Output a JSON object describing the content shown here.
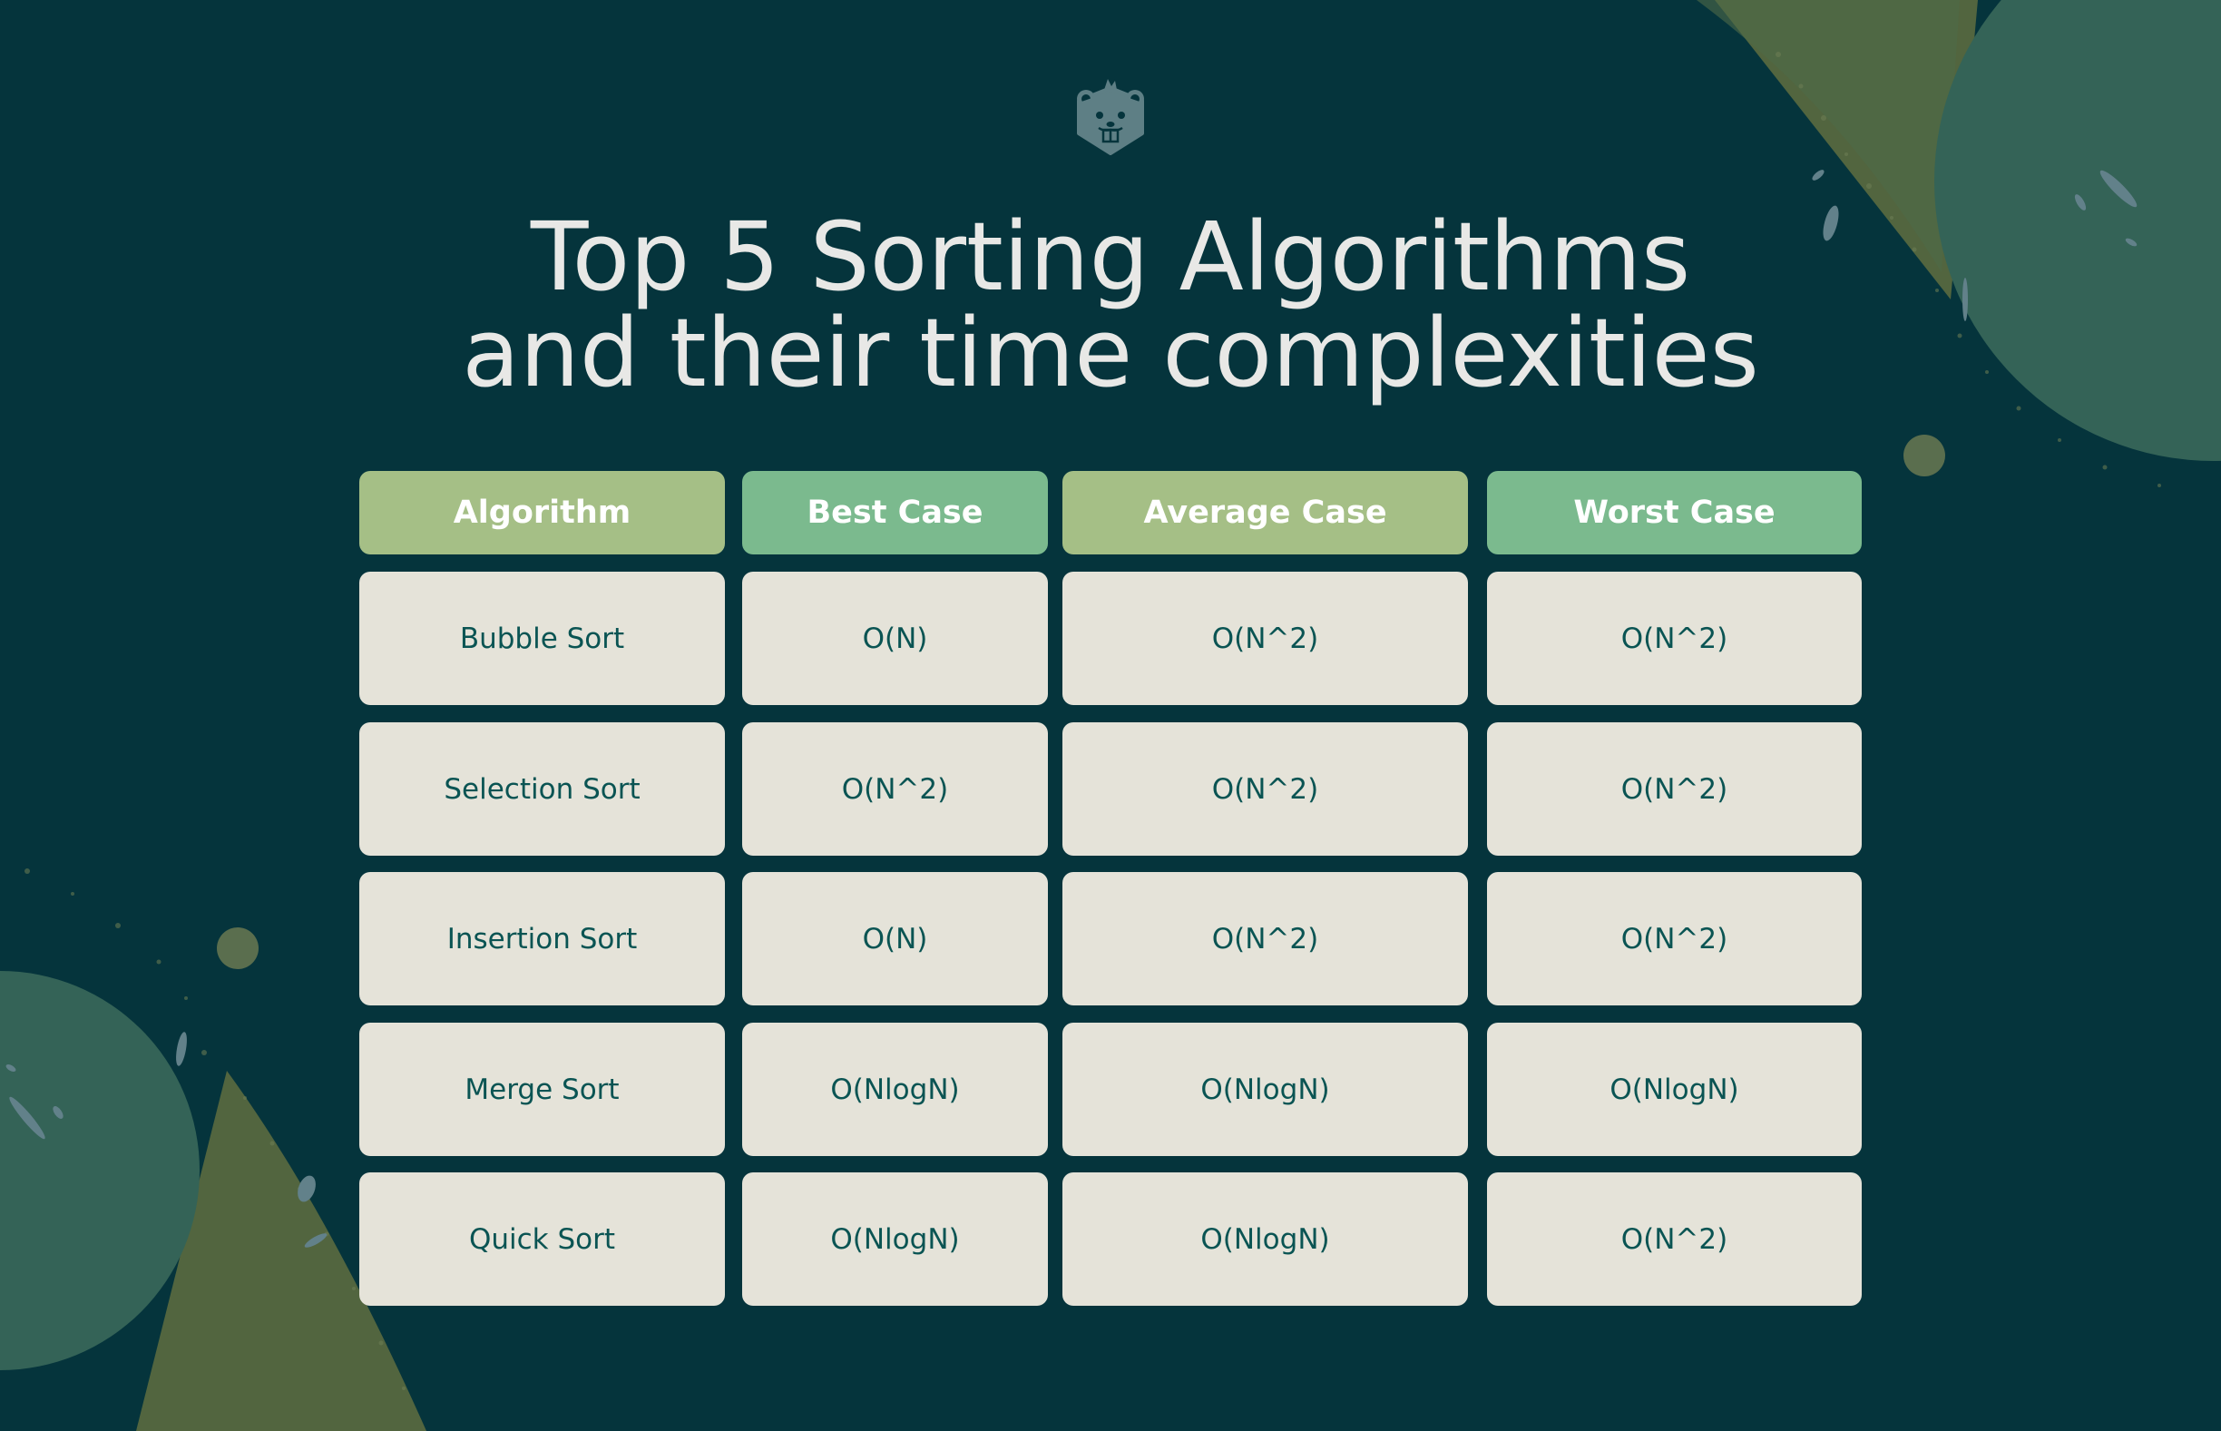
{
  "logo": {
    "icon": "beaver-mascot-icon"
  },
  "title": {
    "line1": "Top 5 Sorting Algorithms",
    "line2": "and their time complexities"
  },
  "table": {
    "headers": [
      "Algorithm",
      "Best Case",
      "Average Case",
      "Worst Case"
    ],
    "rows": [
      [
        "Bubble Sort",
        "O(N)",
        "O(N^2)",
        "O(N^2)"
      ],
      [
        "Selection Sort",
        "O(N^2)",
        "O(N^2)",
        "O(N^2)"
      ],
      [
        "Insertion Sort",
        "O(N)",
        "O(N^2)",
        "O(N^2)"
      ],
      [
        "Merge Sort",
        "O(NlogN)",
        "O(NlogN)",
        "O(NlogN)"
      ],
      [
        "Quick Sort",
        "O(NlogN)",
        "O(NlogN)",
        "O(N^2)"
      ]
    ]
  },
  "colors": {
    "background": "#05343c",
    "header_olive": "#a5bf86",
    "header_mint": "#7bba8e",
    "cell": "#e5e3d9",
    "cell_text": "#0a5453",
    "title_text": "#e8e8e6"
  }
}
